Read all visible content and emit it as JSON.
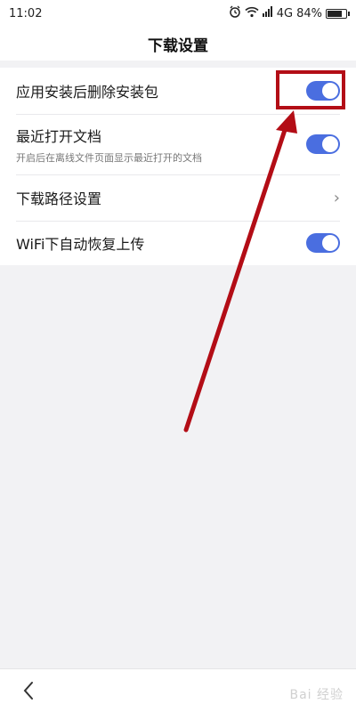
{
  "status": {
    "time": "11:02",
    "network": "4G",
    "battery_text": "84%",
    "battery_level": 0.84
  },
  "header": {
    "title": "下载设置"
  },
  "settings": [
    {
      "title": "应用安装后删除安装包",
      "subtitle": "",
      "control": "toggle",
      "on": true
    },
    {
      "title": "最近打开文档",
      "subtitle": "开启后在离线文件页面显示最近打开的文档",
      "control": "toggle",
      "on": true
    },
    {
      "title": "下载路径设置",
      "subtitle": "",
      "control": "chevron",
      "chevron_glyph": "›"
    },
    {
      "title": "WiFi下自动恢复上传",
      "subtitle": "",
      "control": "toggle",
      "on": true
    }
  ],
  "colors": {
    "toggle_on": "#4a6ee0",
    "annotation_red": "#b30d16"
  },
  "watermark": {
    "text": "Bai 经验"
  }
}
